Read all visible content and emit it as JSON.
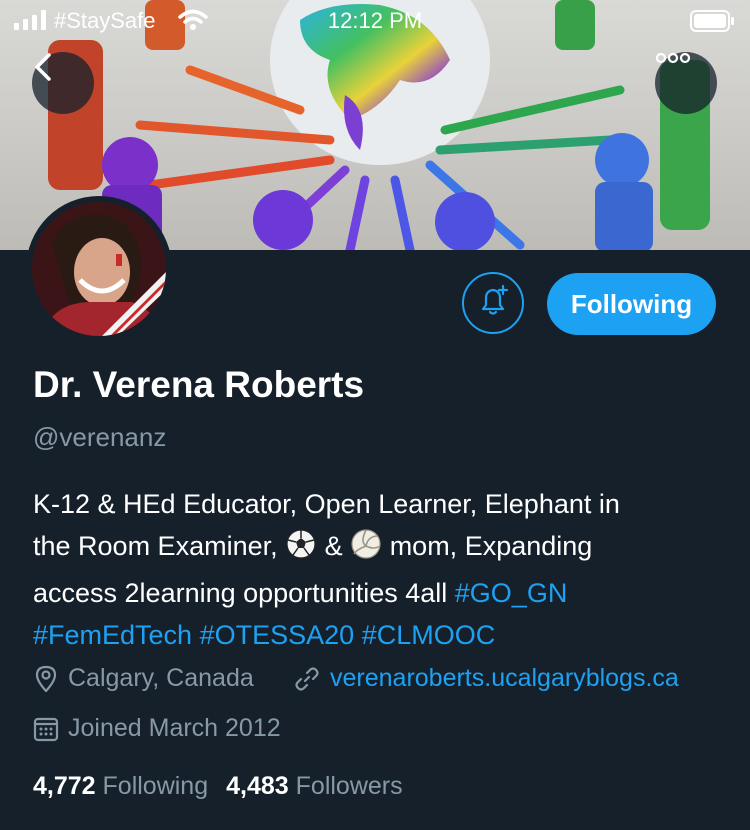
{
  "status_bar": {
    "carrier": "#StaySafe",
    "time": "12:12 PM"
  },
  "profile": {
    "name": "Dr. Verena Roberts",
    "handle": "@verenanz",
    "bio": {
      "line1": "K-12 & HEd Educator, Open Learner, Elephant in",
      "line2_prefix": "the Room Examiner,",
      "line2_amp": "&",
      "line2_suffix": "mom, Expanding",
      "line3_text": "access 2learning opportunities 4all",
      "hashtags": [
        "#GO_GN",
        "#FemEdTech",
        "#OTESSA20",
        "#CLMOOC"
      ]
    },
    "location": "Calgary, Canada",
    "website": "verenaroberts.ucalgaryblogs.ca",
    "joined": "Joined March 2012",
    "following_count": "4,772",
    "following_label": "Following",
    "followers_count": "4,483",
    "followers_label": "Followers"
  },
  "buttons": {
    "following": "Following"
  },
  "icons": {
    "back": "chevron-left-icon",
    "more": "more-horizontal-icon",
    "notify": "bell-plus-icon",
    "location": "location-pin-icon",
    "link": "link-icon",
    "calendar": "calendar-icon",
    "soccer": "soccer-ball-emoji",
    "volleyball": "volleyball-emoji"
  },
  "colors": {
    "background": "#15202b",
    "accent": "#1da1f2",
    "secondary_text": "#8899a6"
  }
}
